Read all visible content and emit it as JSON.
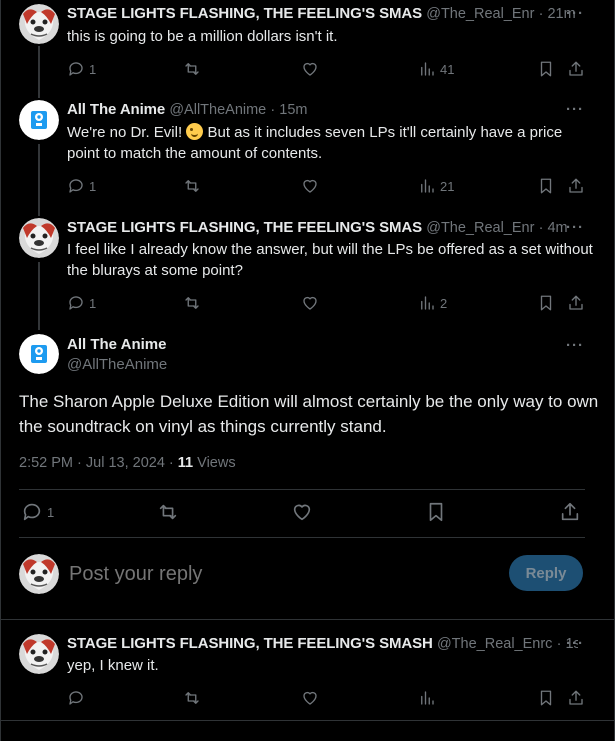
{
  "replies_above": [
    {
      "name": "STAGE LIGHTS FLASHING, THE FEELING'S SMAS",
      "handle": "@The_Real_Enr",
      "time": "· 21m",
      "text": "this is going to be a million dollars isn't it.",
      "stats": {
        "replies": "1",
        "views": "41"
      }
    },
    {
      "name": "All The Anime",
      "handle": "@AllTheAnime",
      "time": "· 15m",
      "text_a": "We're no Dr. Evil!",
      "text_b": "But as it includes seven LPs it'll certainly have a price point to match the amount of contents.",
      "stats": {
        "replies": "1",
        "views": "21"
      }
    },
    {
      "name": "STAGE LIGHTS FLASHING, THE FEELING'S SMAS",
      "handle": "@The_Real_Enr",
      "time": "· 4m",
      "text": "I feel like I already know the answer, but will the LPs be offered as a set without the blurays at some point?",
      "stats": {
        "replies": "1",
        "views": "2"
      }
    }
  ],
  "main_tweet": {
    "name": "All The Anime",
    "handle": "@AllTheAnime",
    "text": "The Sharon Apple Deluxe Edition will almost certainly be the only way to own the soundtrack on vinyl as things currently stand.",
    "timestamp": "2:52 PM · Jul 13, 2024",
    "separator": " · ",
    "views_count": "11",
    "views_label": " Views",
    "stats": {
      "replies": "1"
    }
  },
  "composer": {
    "placeholder": "Post your reply",
    "button_label": "Reply"
  },
  "reply_below": {
    "name": "STAGE LIGHTS FLASHING, THE FEELING'S SMASH",
    "handle": "@The_Real_Enrc",
    "time": "· 1s",
    "text": "yep, I knew it."
  },
  "more_label": "···",
  "colors": {
    "accent_muted": "#1d4f73",
    "text_secondary": "#71767b",
    "logo_blue": "#1d9bf0"
  }
}
